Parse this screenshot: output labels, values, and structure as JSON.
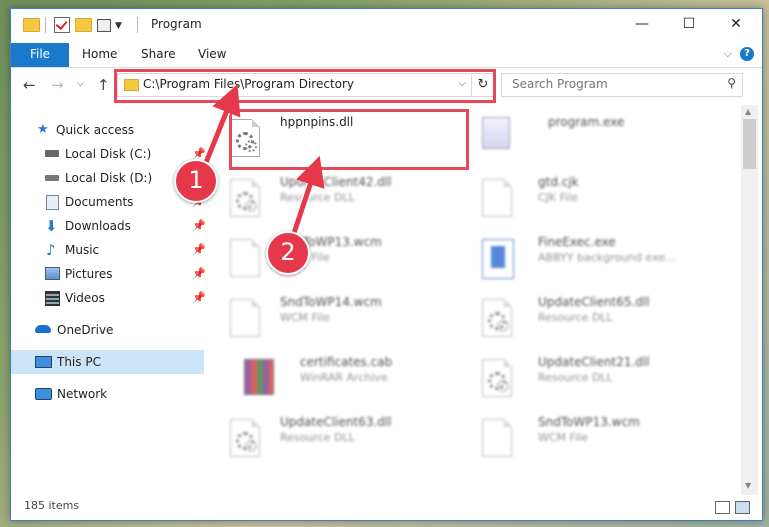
{
  "window": {
    "title": "Program"
  },
  "ribbon": {
    "tabs": [
      "File",
      "Home",
      "Share",
      "View"
    ],
    "help": "?"
  },
  "nav": {
    "address": "C:\\Program Files\\Program Directory",
    "search_placeholder": "Search Program"
  },
  "sidebar": {
    "items": [
      {
        "label": "Quick access",
        "icon": "star-icon",
        "pinned": false
      },
      {
        "label": "Local Disk (C:)",
        "icon": "drive-icon",
        "pinned": true
      },
      {
        "label": "Local Disk (D:)",
        "icon": "drive-icon",
        "pinned": false
      },
      {
        "label": "Documents",
        "icon": "documents-icon",
        "pinned": true
      },
      {
        "label": "Downloads",
        "icon": "download-icon",
        "pinned": true
      },
      {
        "label": "Music",
        "icon": "music-icon",
        "pinned": true
      },
      {
        "label": "Pictures",
        "icon": "pictures-icon",
        "pinned": true
      },
      {
        "label": "Videos",
        "icon": "videos-icon",
        "pinned": true
      },
      {
        "label": "OneDrive",
        "icon": "cloud-icon",
        "pinned": false
      },
      {
        "label": "This PC",
        "icon": "computer-icon",
        "pinned": false,
        "selected": true
      },
      {
        "label": "Network",
        "icon": "network-icon",
        "pinned": false
      }
    ]
  },
  "files": [
    {
      "name": "hppnpins.dll",
      "type": "",
      "icon": "dll-icon"
    },
    {
      "name": "program.exe",
      "type": "",
      "icon": "exe-icon"
    },
    {
      "name": "UpdateClient42.dll",
      "type": "Resource DLL",
      "icon": "dll-icon"
    },
    {
      "name": "gtd.cjk",
      "type": "CJK File",
      "icon": "file-icon"
    },
    {
      "name": "SndToWP13.wcm",
      "type": "WCM File",
      "icon": "file-icon"
    },
    {
      "name": "FineExec.exe",
      "type": "ABBYY background exe...",
      "icon": "app-icon"
    },
    {
      "name": "SndToWP14.wcm",
      "type": "WCM File",
      "icon": "file-icon"
    },
    {
      "name": "UpdateClient65.dll",
      "type": "Resource DLL",
      "icon": "dll-icon"
    },
    {
      "name": "certificates.cab",
      "type": "WinRAR Archive",
      "icon": "archive-icon"
    },
    {
      "name": "UpdateClient21.dll",
      "type": "Resource DLL",
      "icon": "dll-icon"
    },
    {
      "name": "UpdateClient63.dll",
      "type": "Resource DLL",
      "icon": "dll-icon"
    },
    {
      "name": "SndToWP13.wcm",
      "type": "WCM File",
      "icon": "file-icon"
    }
  ],
  "status": {
    "count": "185 items"
  },
  "callouts": [
    "1",
    "2"
  ],
  "colors": {
    "accent": "#1979ca",
    "highlight": "#e3495a",
    "selection": "#cce4f7"
  }
}
